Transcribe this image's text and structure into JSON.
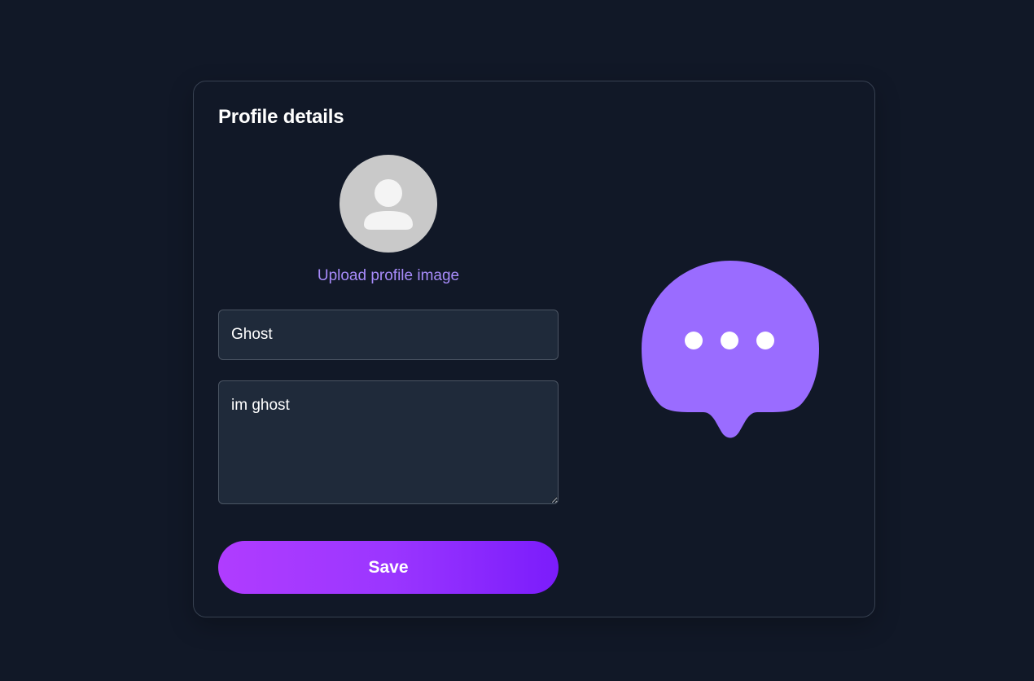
{
  "profile": {
    "title": "Profile details",
    "upload_label": "Upload profile image",
    "name_value": "Ghost",
    "bio_value": "im ghost",
    "save_label": "Save"
  },
  "icons": {
    "avatar": "user-silhouette-icon",
    "illustration": "chat-bubble-typing-icon"
  },
  "colors": {
    "background": "#111827",
    "accent": "#a78bfa",
    "bubble": "#9a6cff",
    "button_gradient_start": "#b03cff",
    "button_gradient_end": "#7b1cfb"
  }
}
